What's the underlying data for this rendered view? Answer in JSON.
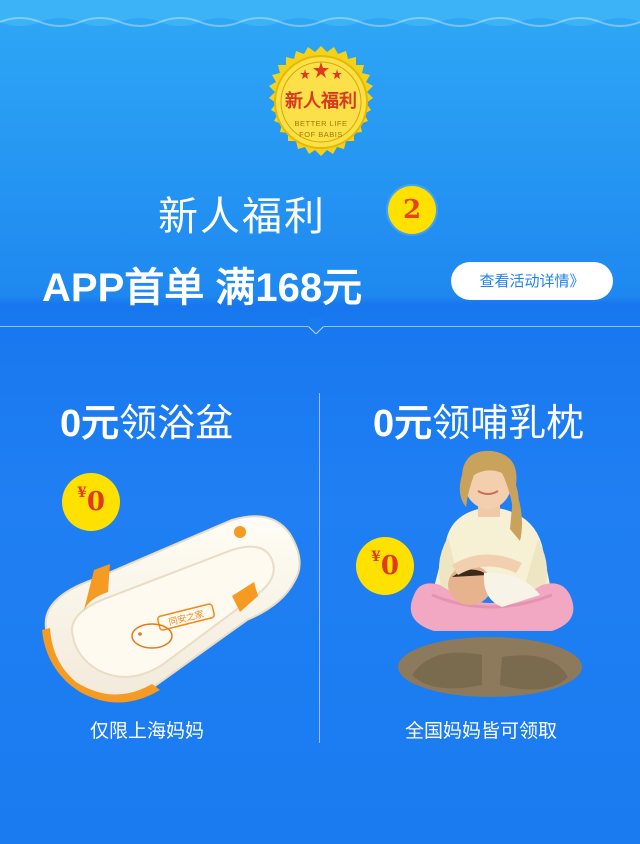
{
  "badge": {
    "title": "新人福利",
    "line1": "BETTER LIFE",
    "line2": "FOF BABIS"
  },
  "hero": {
    "title": "新人福利",
    "number": "2",
    "headline": "APP首单 满168元",
    "detail_button": "查看活动详情》"
  },
  "offers": [
    {
      "title_strong": "0元",
      "title_rest": "领浴盆",
      "price_symbol": "¥",
      "price": "0",
      "caption": "仅限上海妈妈",
      "product_text": "同安之家"
    },
    {
      "title_strong": "0元",
      "title_rest": "领哺乳枕",
      "price_symbol": "¥",
      "price": "0",
      "caption": "全国妈妈皆可领取"
    }
  ],
  "colors": {
    "background": "#1e88f0",
    "accent_yellow": "#ffe100",
    "accent_red": "#e03a1e",
    "button_text": "#1c84ef"
  }
}
